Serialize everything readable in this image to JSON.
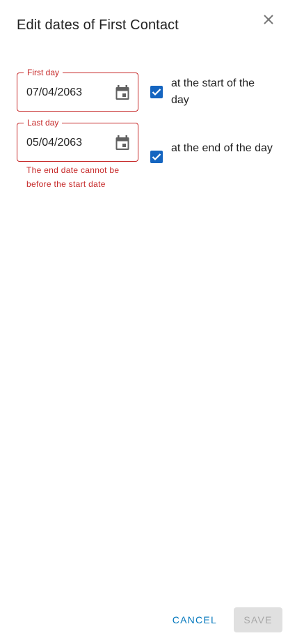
{
  "dialog": {
    "title": "Edit dates of First Contact"
  },
  "first_day": {
    "label": "First day",
    "value": "07/04/2063",
    "checkbox_checked": true,
    "checkbox_label": "at the start of the day"
  },
  "last_day": {
    "label": "Last day",
    "value": "05/04/2063",
    "error": "The end date cannot be before the start date",
    "checkbox_checked": true,
    "checkbox_label": "at the end of the day"
  },
  "actions": {
    "cancel_label": "CANCEL",
    "save_label": "SAVE",
    "save_disabled": true
  },
  "colors": {
    "error": "#c62828",
    "checkbox": "#1565c0",
    "primary_text_button": "#0277bd"
  },
  "icons": {
    "close": "close-icon",
    "calendar": "calendar-icon",
    "check": "check-icon"
  }
}
